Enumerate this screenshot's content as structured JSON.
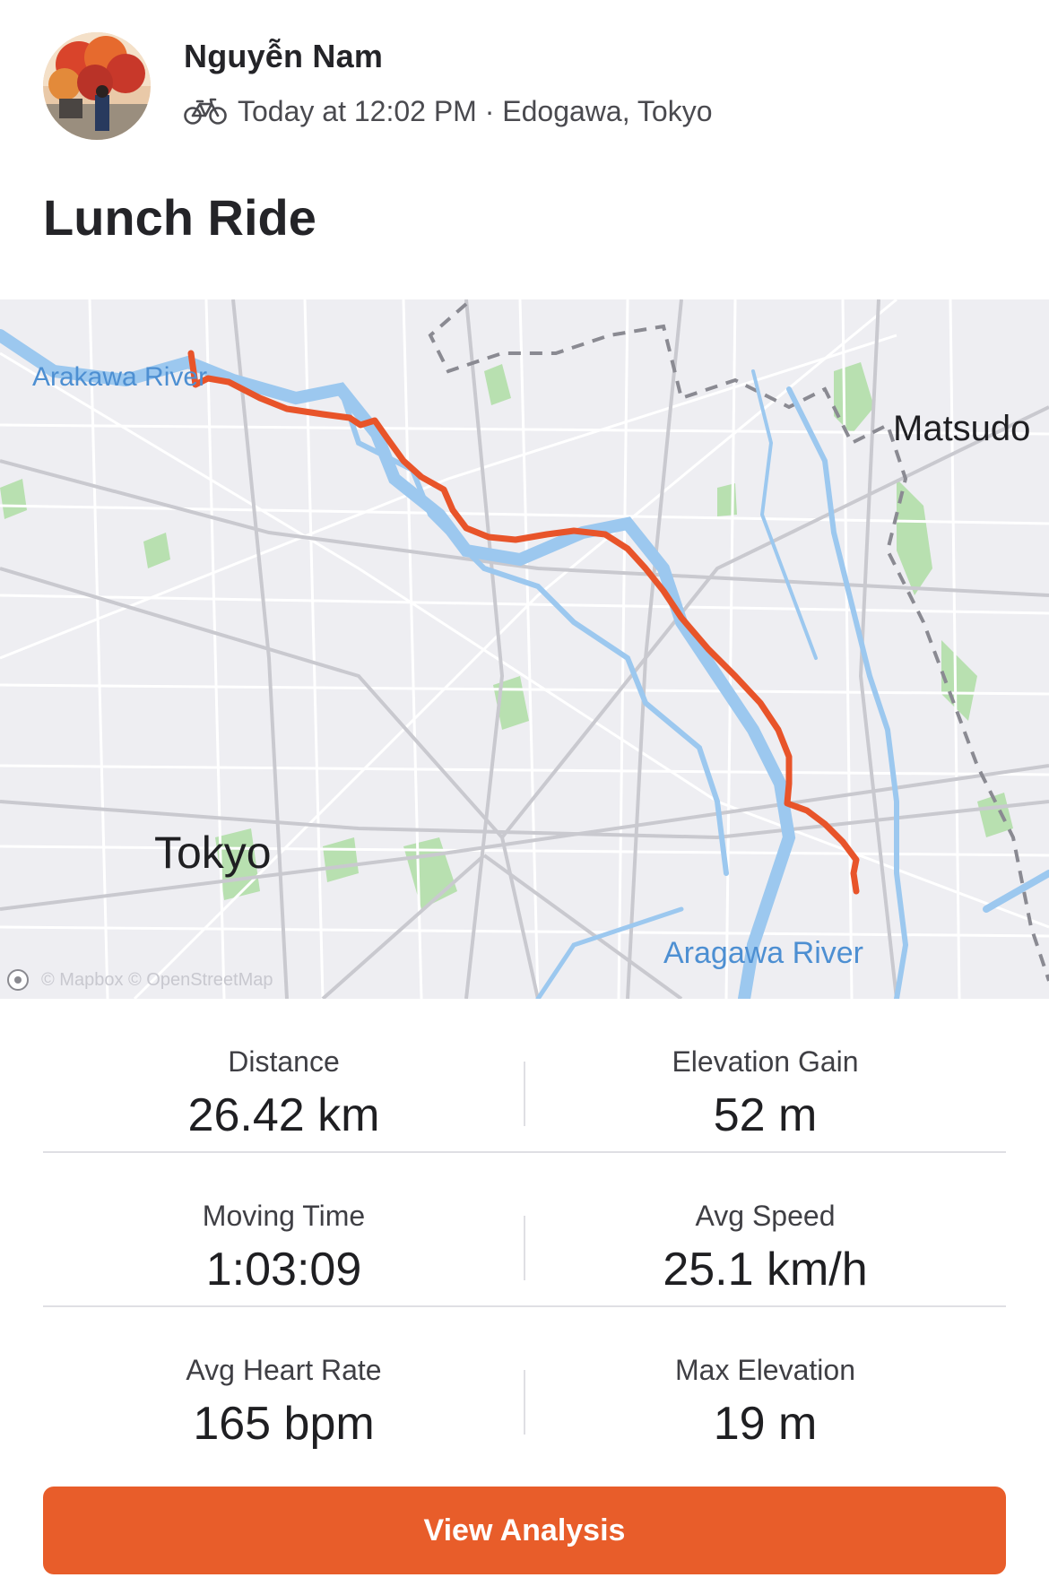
{
  "athlete": {
    "name": "Nguyễn Nam",
    "avatar": "avatar-photo"
  },
  "activity": {
    "sport_icon": "bike-icon",
    "meta": "Today at 12:02 PM · Edogawa, Tokyo",
    "title": "Lunch Ride"
  },
  "map": {
    "labels": {
      "tokyo": "Tokyo",
      "matsudo": "Matsudo",
      "arakawa_river": "Arakawa River",
      "aragawa_river": "Aragawa River"
    },
    "attribution": "© Mapbox © OpenStreetMap",
    "route_color": "#e8542a"
  },
  "stats": {
    "distance": {
      "label": "Distance",
      "value": "26.42 km"
    },
    "elevation_gain": {
      "label": "Elevation Gain",
      "value": "52 m"
    },
    "moving_time": {
      "label": "Moving Time",
      "value": "1:03:09"
    },
    "avg_speed": {
      "label": "Avg Speed",
      "value": "25.1 km/h"
    },
    "avg_heart_rate": {
      "label": "Avg Heart Rate",
      "value": "165 bpm"
    },
    "max_elevation": {
      "label": "Max Elevation",
      "value": "19 m"
    }
  },
  "actions": {
    "view_analysis": "View Analysis"
  },
  "colors": {
    "accent": "#e85d2a",
    "water": "#9cc8ef",
    "park": "#b8e0b0"
  }
}
